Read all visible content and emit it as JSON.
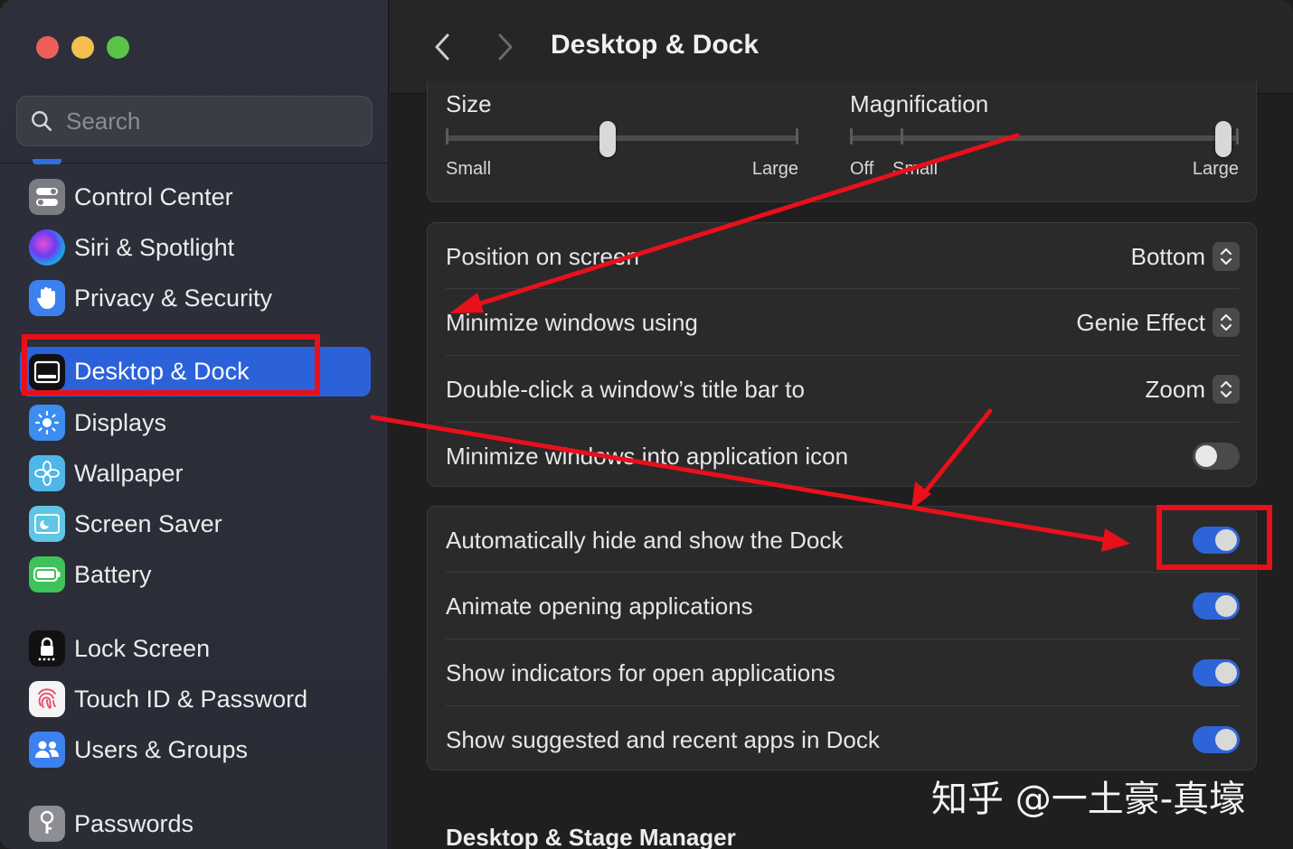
{
  "search": {
    "placeholder": "Search"
  },
  "sidebar": {
    "items": [
      {
        "label": "Control Center",
        "icon": "control-center-icon"
      },
      {
        "label": "Siri & Spotlight",
        "icon": "siri-icon"
      },
      {
        "label": "Privacy & Security",
        "icon": "hand-icon"
      },
      {
        "label": "Desktop & Dock",
        "icon": "dock-icon",
        "selected": true
      },
      {
        "label": "Displays",
        "icon": "sun-icon"
      },
      {
        "label": "Wallpaper",
        "icon": "flower-icon"
      },
      {
        "label": "Screen Saver",
        "icon": "screen-saver-icon"
      },
      {
        "label": "Battery",
        "icon": "battery-icon"
      },
      {
        "label": "Lock Screen",
        "icon": "lock-icon"
      },
      {
        "label": "Touch ID & Password",
        "icon": "fingerprint-icon"
      },
      {
        "label": "Users & Groups",
        "icon": "users-icon"
      },
      {
        "label": "Passwords",
        "icon": "key-icon"
      }
    ]
  },
  "header": {
    "title": "Desktop & Dock"
  },
  "dock_size": {
    "title": "Size",
    "min_label": "Small",
    "max_label": "Large",
    "value_fraction": 0.46
  },
  "magnification": {
    "title": "Magnification",
    "off_label": "Off",
    "min_label": "Small",
    "max_label": "Large",
    "value_fraction": 1.0
  },
  "settings_group_1": [
    {
      "label": "Position on screen",
      "value": "Bottom"
    },
    {
      "label": "Minimize windows using",
      "value": "Genie Effect"
    },
    {
      "label": "Double-click a window’s title bar to",
      "value": "Zoom"
    },
    {
      "label": "Minimize windows into application icon",
      "toggle": false
    }
  ],
  "settings_group_2": [
    {
      "label": "Automatically hide and show the Dock",
      "toggle": true
    },
    {
      "label": "Animate opening applications",
      "toggle": true
    },
    {
      "label": "Show indicators for open applications",
      "toggle": true
    },
    {
      "label": "Show suggested and recent apps in Dock",
      "toggle": true
    }
  ],
  "next_section": "Desktop & Stage Manager",
  "watermark": "知乎 @一土豪-真壕",
  "colors": {
    "accent": "#2b62d9",
    "annotation": "#e8101b",
    "traffic_red": "#ec5f59",
    "traffic_yellow": "#f4bf4f",
    "traffic_green": "#59c34a"
  }
}
